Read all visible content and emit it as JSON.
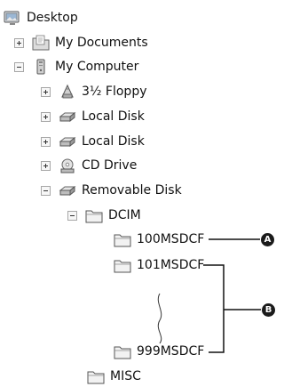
{
  "tree": {
    "desktop": {
      "label": "Desktop",
      "icon": "desktop-icon"
    },
    "my_documents": {
      "label": "My Documents",
      "icon": "my-documents-icon"
    },
    "my_computer": {
      "label": "My Computer",
      "icon": "my-computer-icon"
    },
    "floppy": {
      "label": "3½ Floppy",
      "icon": "floppy-icon"
    },
    "local_disk_1": {
      "label": "Local Disk",
      "icon": "drive-icon"
    },
    "local_disk_2": {
      "label": "Local Disk",
      "icon": "drive-icon"
    },
    "cd_drive": {
      "label": "CD Drive",
      "icon": "cd-drive-icon"
    },
    "removable_disk": {
      "label": "Removable Disk",
      "icon": "drive-icon"
    },
    "dcim": {
      "label": "DCIM",
      "icon": "folder-icon"
    },
    "folder_100": {
      "label": "100MSDCF",
      "icon": "folder-icon"
    },
    "folder_101": {
      "label": "101MSDCF",
      "icon": "folder-icon"
    },
    "folder_999": {
      "label": "999MSDCF",
      "icon": "folder-icon"
    },
    "misc": {
      "label": "MISC",
      "icon": "folder-icon"
    }
  },
  "callouts": {
    "a": "A",
    "b": "B"
  }
}
